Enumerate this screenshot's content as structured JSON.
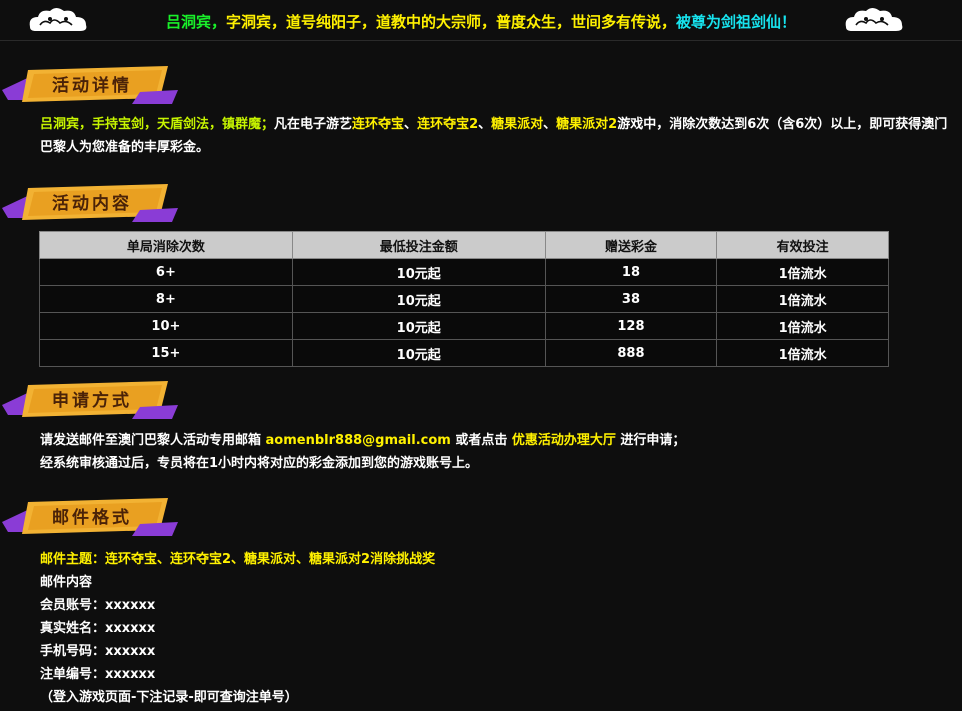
{
  "banner": {
    "part1": "吕洞宾，",
    "part2": "字洞宾，道号纯阳子，道教中的大宗师，普度众生，世间多有传说，",
    "part3": "被尊为剑祖剑仙！"
  },
  "sections": {
    "details_title": "活动详情",
    "content_title": "活动内容",
    "apply_title": "申请方式",
    "mail_title": "邮件格式"
  },
  "details": {
    "intro": "吕洞宾，手持宝剑，天盾剑法，镇群魔；",
    "mid1": "凡在电子游艺",
    "game1": "连环夺宝",
    "sep1": "、",
    "game2": "连环夺宝2",
    "sep2": "、",
    "game3": "糖果派对",
    "sep3": "、",
    "game4": "糖果派对2",
    "rest": "游戏中，消除次数达到6次（含6次）以上，即可获得澳门巴黎人为您准备的丰厚彩金。"
  },
  "table": {
    "headers": [
      "单局消除次数",
      "最低投注金额",
      "赠送彩金",
      "有效投注"
    ],
    "rows": [
      [
        "6+",
        "10元起",
        "18",
        "1倍流水"
      ],
      [
        "8+",
        "10元起",
        "38",
        "1倍流水"
      ],
      [
        "10+",
        "10元起",
        "128",
        "1倍流水"
      ],
      [
        "15+",
        "10元起",
        "888",
        "1倍流水"
      ]
    ]
  },
  "apply": {
    "line1_pre": "请发送邮件至澳门巴黎人活动专用邮箱 ",
    "email": "aomenblr888@gmail.com",
    "line1_mid": " 或者点击 ",
    "hall_link": "优惠活动办理大厅",
    "line1_post": " 进行申请；",
    "line2": "经系统审核通过后，专员将在1小时内将对应的彩金添加到您的游戏账号上。"
  },
  "mail": {
    "subject": "邮件主题：连环夺宝、连环夺宝2、糖果派对、糖果派对2消除挑战奖",
    "content_label": "邮件内容",
    "account": "会员账号：xxxxxx",
    "real_name": "真实姓名：xxxxxx",
    "phone": "手机号码：xxxxxx",
    "order_no": "注单编号：xxxxxx",
    "note": "（登入游戏页面-下注记录-即可查询注单号）"
  },
  "colors": {
    "background": "#0e0e0e",
    "highlight_yellow": "#fff100",
    "highlight_green": "#19f12a",
    "highlight_cyan": "#17e3ee",
    "ribbon_gold": "#f2b233",
    "ribbon_purple": "#8a3cd6"
  }
}
